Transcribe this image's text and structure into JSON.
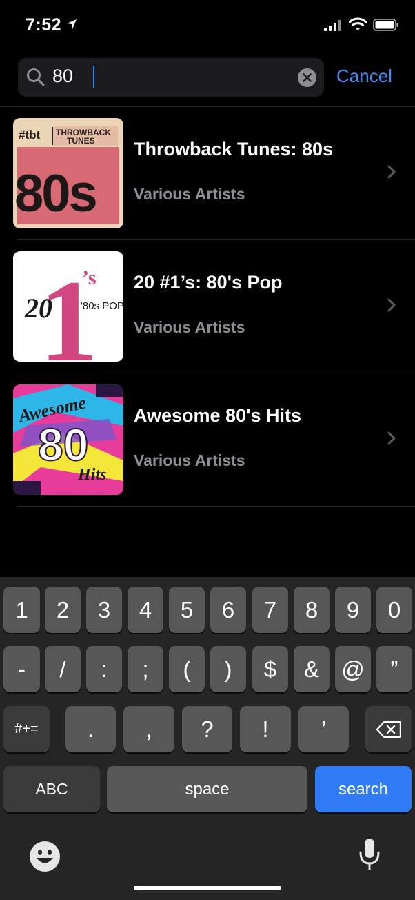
{
  "status_bar": {
    "time": "7:52"
  },
  "search": {
    "query": "80",
    "cancel_label": "Cancel"
  },
  "results": [
    {
      "title": "Throwback Tunes: 80s",
      "subtitle": "Various Artists",
      "art": {
        "tag": "#tbt",
        "line1": "THROWBACK",
        "line2": "TUNES",
        "big": "80s"
      }
    },
    {
      "title": "20 #1’s: 80's Pop",
      "subtitle": "Various Artists",
      "art": {
        "left": "20",
        "one": "1",
        "sup": "’s",
        "sub": "'80s POP"
      }
    },
    {
      "title": "Awesome 80's Hits",
      "subtitle": "Various Artists",
      "art": {
        "top": "Awesome",
        "mid": "80",
        "bottom": "Hits"
      }
    }
  ],
  "keyboard": {
    "row1": [
      "1",
      "2",
      "3",
      "4",
      "5",
      "6",
      "7",
      "8",
      "9",
      "0"
    ],
    "row2": [
      "-",
      "/",
      ":",
      ";",
      "(",
      ")",
      "$",
      "&",
      "@",
      "”"
    ],
    "row3": {
      "mode": "#+=",
      "keys": [
        ".",
        ",",
        "?",
        "!",
        "’"
      ]
    },
    "row4": {
      "abc": "ABC",
      "space": "space",
      "search": "search"
    }
  },
  "colors": {
    "accent": "#3d8df5",
    "search_key": "#2f7cf6",
    "background": "#000000",
    "secondary_text": "#8e8e93"
  }
}
